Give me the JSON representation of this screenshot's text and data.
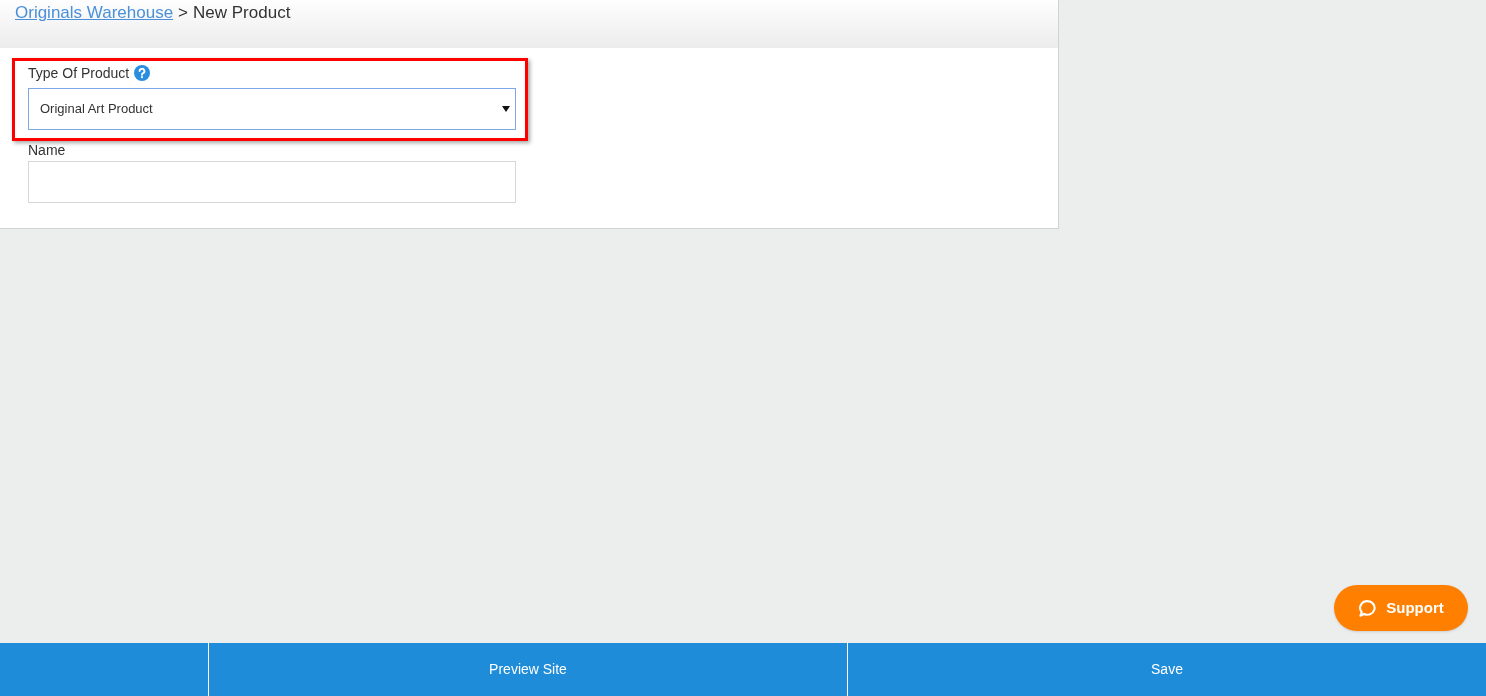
{
  "breadcrumb": {
    "items": [
      {
        "label": "Originals Warehouse",
        "kind": "link"
      },
      {
        "label": "New Product",
        "kind": "current"
      }
    ],
    "separator": ">"
  },
  "form": {
    "fields": [
      {
        "label": "Type Of Product",
        "kind": "select",
        "value": "Original Art Product",
        "help": true,
        "highlighted": true,
        "focused": true
      },
      {
        "label": "Name",
        "kind": "text",
        "focused": false
      }
    ]
  },
  "support_button": {
    "label": "Support"
  },
  "footer": {
    "buttons": [
      {
        "label": "Preview Site"
      },
      {
        "label": "Save"
      }
    ]
  }
}
